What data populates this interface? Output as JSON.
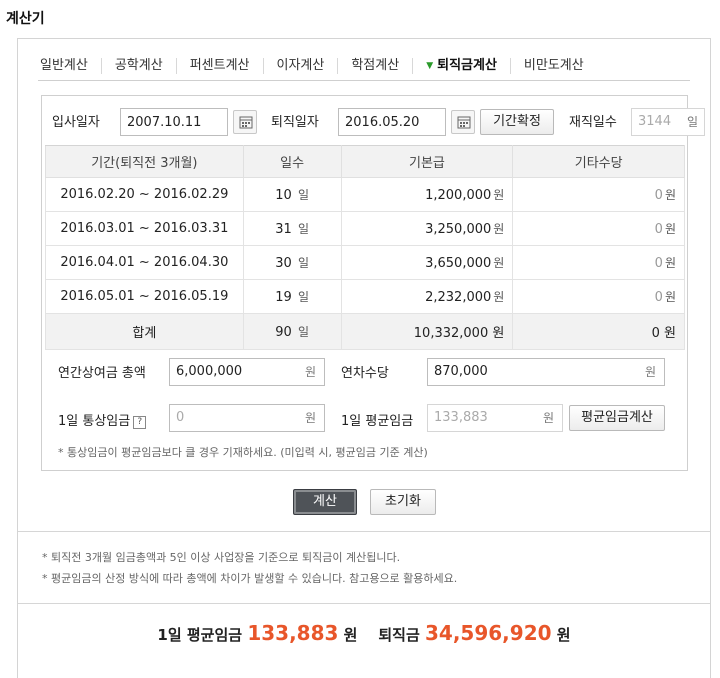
{
  "page_title": "계산기",
  "tabs": [
    {
      "label": "일반계산",
      "active": false
    },
    {
      "label": "공학계산",
      "active": false
    },
    {
      "label": "퍼센트계산",
      "active": false
    },
    {
      "label": "이자계산",
      "active": false
    },
    {
      "label": "학점계산",
      "active": false
    },
    {
      "label": "퇴직금계산",
      "active": true
    },
    {
      "label": "비만도계산",
      "active": false
    }
  ],
  "dates": {
    "join_label": "입사일자",
    "join_value": "2007.10.11",
    "leave_label": "퇴직일자",
    "leave_value": "2016.05.20",
    "confirm_button": "기간확정",
    "tenure_label": "재직일수",
    "tenure_value": "3144",
    "tenure_unit": "일"
  },
  "table": {
    "headers": [
      "기간(퇴직전 3개월)",
      "일수",
      "기본급",
      "기타수당"
    ],
    "rows": [
      {
        "period": "2016.02.20 ~ 2016.02.29",
        "days": "10",
        "base": "1,200,000",
        "other": "0"
      },
      {
        "period": "2016.03.01 ~ 2016.03.31",
        "days": "31",
        "base": "3,250,000",
        "other": "0"
      },
      {
        "period": "2016.04.01 ~ 2016.04.30",
        "days": "30",
        "base": "3,650,000",
        "other": "0"
      },
      {
        "period": "2016.05.01 ~ 2016.05.19",
        "days": "19",
        "base": "2,232,000",
        "other": "0"
      }
    ],
    "day_unit": "일",
    "won_unit": "원",
    "sum": {
      "label": "합계",
      "days": "90",
      "base": "10,332,000",
      "other": "0"
    }
  },
  "fields": {
    "bonus_label": "연간상여금 총액",
    "bonus_value": "6,000,000",
    "bonus_unit": "원",
    "annual_leave_label": "연차수당",
    "annual_leave_value": "870,000",
    "annual_leave_unit": "원",
    "ordinary_wage_label": "1일 통상임금",
    "ordinary_wage_help": "?",
    "ordinary_wage_placeholder": "0",
    "ordinary_wage_unit": "원",
    "avg_wage_label": "1일 평균임금",
    "avg_wage_value": "133,883",
    "avg_wage_unit": "원",
    "avg_wage_button": "평균임금계산",
    "note": "* 통상임금이 평균임금보다 클 경우 기재하세요. (미입력 시, 평균임금 기준 계산)"
  },
  "actions": {
    "calculate": "계산",
    "reset": "초기화"
  },
  "footnotes": [
    "* 퇴직전 3개월 임금총액과 5인 이상 사업장을 기준으로 퇴직금이 계산됩니다.",
    "* 평균임금의 산정 방식에 따라 총액에 차이가 발생할 수 있습니다. 참고용으로 활용하세요."
  ],
  "result": {
    "avg_label": "1일 평균임금",
    "avg_value": "133,883",
    "avg_unit": "원",
    "severance_label": "퇴직금",
    "severance_value": "34,596,920",
    "severance_unit": "원"
  },
  "colors": {
    "accent": "#e8562a",
    "active_tab_arrow": "#2a9a2a",
    "calc_button": "#4f5358"
  }
}
